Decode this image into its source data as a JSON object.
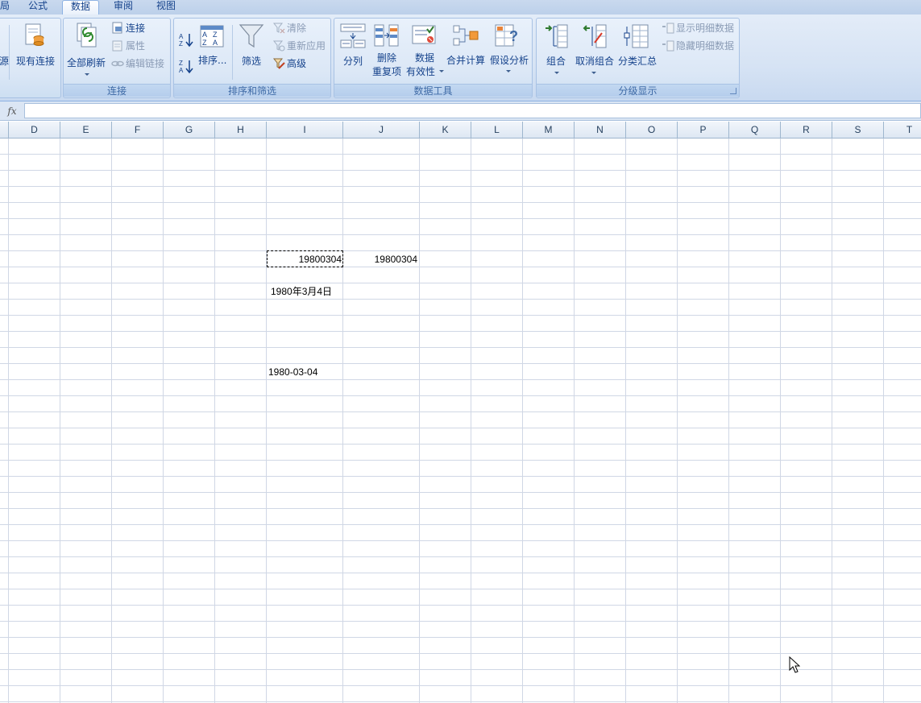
{
  "tabs": [
    {
      "label": "局",
      "active": false
    },
    {
      "label": "公式",
      "active": false
    },
    {
      "label": "数据",
      "active": true
    },
    {
      "label": "审阅",
      "active": false
    },
    {
      "label": "视图",
      "active": false
    }
  ],
  "ribbon": {
    "get_external": {
      "source_partial": "源",
      "existing_connections": "现有连接"
    },
    "connections": {
      "refresh_all": "全部刷新",
      "connections": "连接",
      "properties": "属性",
      "edit_links": "编辑链接",
      "group_label": "连接"
    },
    "sort_filter": {
      "sort": "排序...",
      "filter": "筛选",
      "clear": "清除",
      "reapply": "重新应用",
      "advanced": "高级",
      "group_label": "排序和筛选"
    },
    "data_tools": {
      "text_to_columns": "分列",
      "remove_duplicates_1": "删除",
      "remove_duplicates_2": "重复项",
      "validation_1": "数据",
      "validation_2": "有效性",
      "consolidate": "合并计算",
      "what_if": "假设分析",
      "group_label": "数据工具"
    },
    "outline": {
      "group": "组合",
      "ungroup": "取消组合",
      "subtotal": "分类汇总",
      "show_detail": "显示明细数据",
      "hide_detail": "隐藏明细数据",
      "group_label": "分级显示"
    }
  },
  "formula_bar": {
    "fx": "fx",
    "value": ""
  },
  "sheet": {
    "columns": [
      "D",
      "E",
      "F",
      "G",
      "H",
      "I",
      "J",
      "K",
      "L",
      "M",
      "N",
      "O",
      "P",
      "Q",
      "R",
      "S",
      "T"
    ],
    "cells": {
      "i_row8": "19800304",
      "j_row8": "19800304",
      "i_row10": "1980年3月4日",
      "i_row15": "1980-03-04"
    }
  },
  "colors": {
    "ribbon_text": "#15428b",
    "gridline": "#d0d7e5",
    "header_bg": "#dde7f3"
  }
}
